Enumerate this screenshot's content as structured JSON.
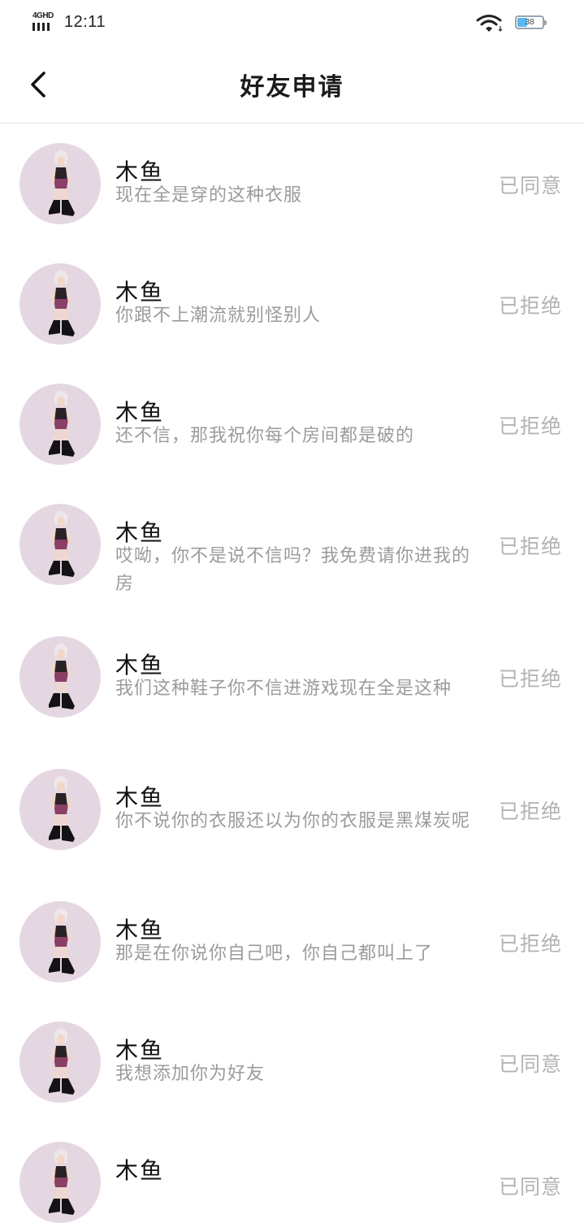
{
  "status_bar": {
    "network": "4GHD",
    "time": "12:11",
    "battery_level": "38"
  },
  "header": {
    "title": "好友申请"
  },
  "requests": [
    {
      "name": "木鱼",
      "message": "现在全是穿的这种衣服",
      "status": "已同意"
    },
    {
      "name": "木鱼",
      "message": "你跟不上潮流就别怪别人",
      "status": "已拒绝"
    },
    {
      "name": "木鱼",
      "message": "还不信，那我祝你每个房间都是破的",
      "status": "已拒绝"
    },
    {
      "name": "木鱼",
      "message": "哎呦，你不是说不信吗？我免费请你进我的房",
      "status": "已拒绝"
    },
    {
      "name": "木鱼",
      "message": "我们这种鞋子你不信进游戏现在全是这种",
      "status": "已拒绝"
    },
    {
      "name": "木鱼",
      "message": "你不说你的衣服还以为你的衣服是黑煤炭呢",
      "status": "已拒绝"
    },
    {
      "name": "木鱼",
      "message": "那是在你说你自己吧，你自己都叫上了",
      "status": "已拒绝"
    },
    {
      "name": "木鱼",
      "message": "我想添加你为好友",
      "status": "已同意"
    },
    {
      "name": "木鱼",
      "message": "",
      "status": "已同意"
    }
  ],
  "colors": {
    "avatar_bg": "#e5d7e2",
    "status_text": "#b3b3b3",
    "message_text": "#9b9b9b"
  }
}
